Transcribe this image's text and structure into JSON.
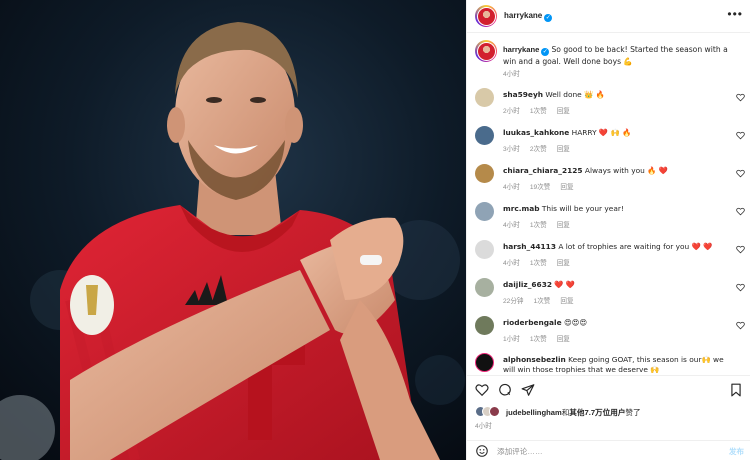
{
  "post": {
    "username": "harrykane",
    "caption_user": "harrykane",
    "caption_text": "So good to be back! Started the season with a win and a goal. Well done boys 💪",
    "caption_time": "4小时"
  },
  "comments": [
    {
      "user": "sha59eyh",
      "text": "Well done 👑 🔥",
      "time": "2小时",
      "likes": "1次赞",
      "reply": "回复",
      "avatar_color": "#d8c9a8"
    },
    {
      "user": "luukas_kahkone",
      "text": "HARRY ❤️ 🙌 🔥",
      "time": "3小时",
      "likes": "2次赞",
      "reply": "回复",
      "avatar_color": "#4a6b8c"
    },
    {
      "user": "chiara_chiara_2125",
      "text": "Always with you 🔥 ❤️",
      "time": "4小时",
      "likes": "19次赞",
      "reply": "回复",
      "avatar_color": "#b58a4a"
    },
    {
      "user": "mrc.mab",
      "text": "This will be your year!",
      "time": "4小时",
      "likes": "1次赞",
      "reply": "回复",
      "avatar_color": "#8fa3b5"
    },
    {
      "user": "harsh_44113",
      "text": "A lot of trophies are waiting for you ❤️ ❤️",
      "time": "4小时",
      "likes": "1次赞",
      "reply": "回复",
      "avatar_color": "#dbdbdb"
    },
    {
      "user": "daijliz_6632",
      "text": "❤️ ❤️",
      "time": "22分钟",
      "likes": "1次赞",
      "reply": "回复",
      "avatar_color": "#a7b0a0"
    },
    {
      "user": "rioderbengale",
      "text": "😍😍😍",
      "time": "1小时",
      "likes": "1次赞",
      "reply": "回复",
      "avatar_color": "#6f7a5c"
    },
    {
      "user": "alphonsebezlin",
      "text": "Keep going GOAT, this season is our🙌 we will win those trophies that we deserve 🙌",
      "time": "",
      "likes": "",
      "reply": "",
      "avatar_color": "#111111"
    }
  ],
  "likes": {
    "user": "judebellingham",
    "text_prefix": "和",
    "count_text": "其他7.7万位用户",
    "text_suffix": "赞了"
  },
  "post_time": "4小时",
  "add_comment": {
    "placeholder": "添加评论……",
    "post_label": "发布"
  },
  "icons": {
    "more": "more-options-icon",
    "verified": "verified-badge-icon",
    "heart": "heart-icon",
    "comment": "comment-icon",
    "share": "share-icon",
    "save": "bookmark-icon",
    "emoji": "emoji-icon"
  },
  "colors": {
    "accent": "#0095f6",
    "like_red": "#ed4956",
    "jersey_red": "#d21f2e"
  }
}
